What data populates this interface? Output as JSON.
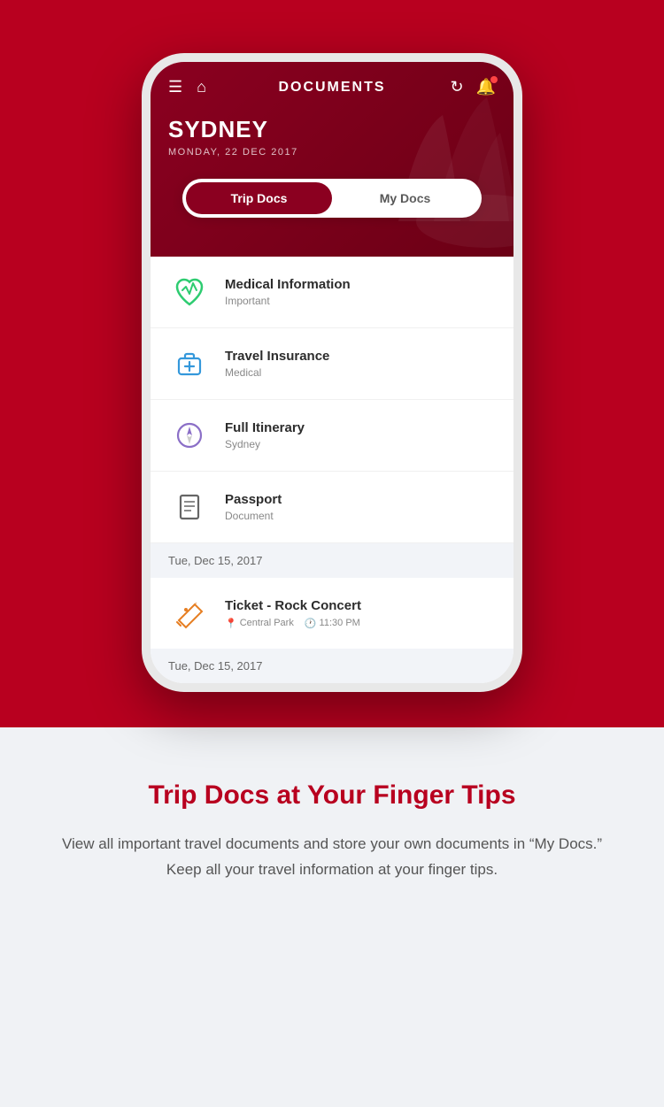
{
  "header": {
    "title": "DOCUMENTS",
    "city": "SYDNEY",
    "date": "MONDAY, 22 DEC 2017"
  },
  "tabs": [
    {
      "label": "Trip Docs",
      "active": true
    },
    {
      "label": "My Docs",
      "active": false
    }
  ],
  "documents": [
    {
      "id": "medical",
      "title": "Medical Information",
      "subtitle": "Important",
      "icon": "heart-icon"
    },
    {
      "id": "insurance",
      "title": "Travel Insurance",
      "subtitle": "Medical",
      "icon": "medkit-icon"
    },
    {
      "id": "itinerary",
      "title": "Full Itinerary",
      "subtitle": "Sydney",
      "icon": "compass-icon"
    },
    {
      "id": "passport",
      "title": "Passport",
      "subtitle": "Document",
      "icon": "passport-icon"
    }
  ],
  "section_date": "Tue, Dec 15, 2017",
  "ticket": {
    "title": "Ticket - Rock Concert",
    "location": "Central Park",
    "time": "11:30 PM"
  },
  "section_date2": "Tue, Dec 15, 2017",
  "bottom": {
    "title": "Trip Docs at Your Finger Tips",
    "description": "View all important travel documents and store your own documents in “My Docs.” Keep all your travel information at your finger tips."
  }
}
